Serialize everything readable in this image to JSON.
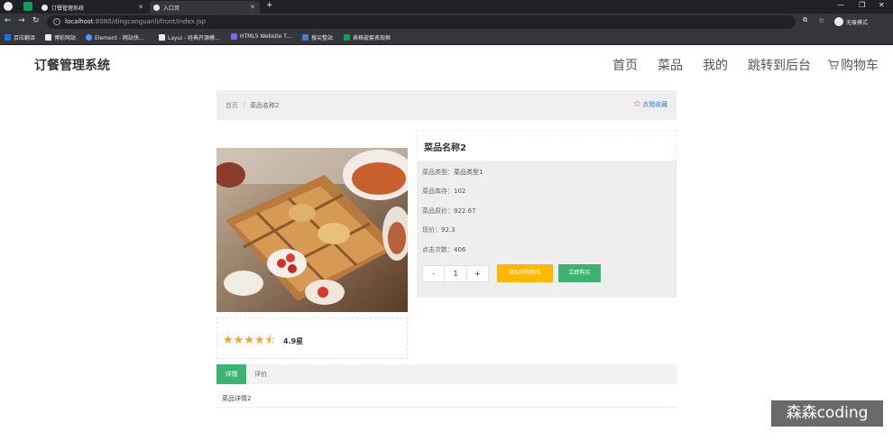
{
  "browser": {
    "tabs": [
      {
        "label": "订餐管理系统"
      },
      {
        "label": "入口页"
      }
    ],
    "new_tab": "+",
    "window_controls": [
      "—",
      "❐",
      "✕"
    ],
    "url": {
      "host": "localhost",
      "path": ":8080/dingcanguanli/front/index.jsp"
    },
    "incognito_label": "无痕模式",
    "bookmarks": [
      {
        "label": "百应翻译"
      },
      {
        "label": "博彩网站"
      },
      {
        "label": "Element - 网站快..."
      },
      {
        "label": "Layui - 经典开源模..."
      },
      {
        "label": "HTML5 Website T..."
      },
      {
        "label": "搜尖整站"
      },
      {
        "label": "表格嵌套表现框"
      }
    ]
  },
  "header": {
    "logo": "订餐管理系统",
    "nav": [
      {
        "label": "首页"
      },
      {
        "label": "菜品"
      },
      {
        "label": "我的"
      },
      {
        "label": "跳转到后台"
      },
      {
        "label": "购物车"
      }
    ]
  },
  "breadcrumb": {
    "home": "首页",
    "separator": "/",
    "current": "菜品名称2",
    "favorite": "点我收藏"
  },
  "product": {
    "title": "菜品名称2",
    "rows": [
      {
        "label": "菜品类型：",
        "value": "菜品类型1"
      },
      {
        "label": "菜品库存：",
        "value": "102"
      },
      {
        "label": "菜品原价：",
        "value": "922.67"
      },
      {
        "label": "现价：",
        "value": "92.3"
      },
      {
        "label": "点击次数：",
        "value": "406"
      }
    ],
    "quantity": {
      "minus": "-",
      "value": "1",
      "plus": "+"
    },
    "add_to_cart": "添加到购物车",
    "buy_now": "立即购买",
    "rating": {
      "stars": "★★★★⯪",
      "score": "4.9星",
      "value": 4.9
    }
  },
  "tabs": {
    "detail": "详情",
    "review": "评价",
    "detail_text": "菜品详情2"
  },
  "watermark": "森森coding",
  "colors": {
    "accent_green": "#3cb371",
    "accent_yellow": "#ffb800",
    "star": "#f5a623"
  }
}
